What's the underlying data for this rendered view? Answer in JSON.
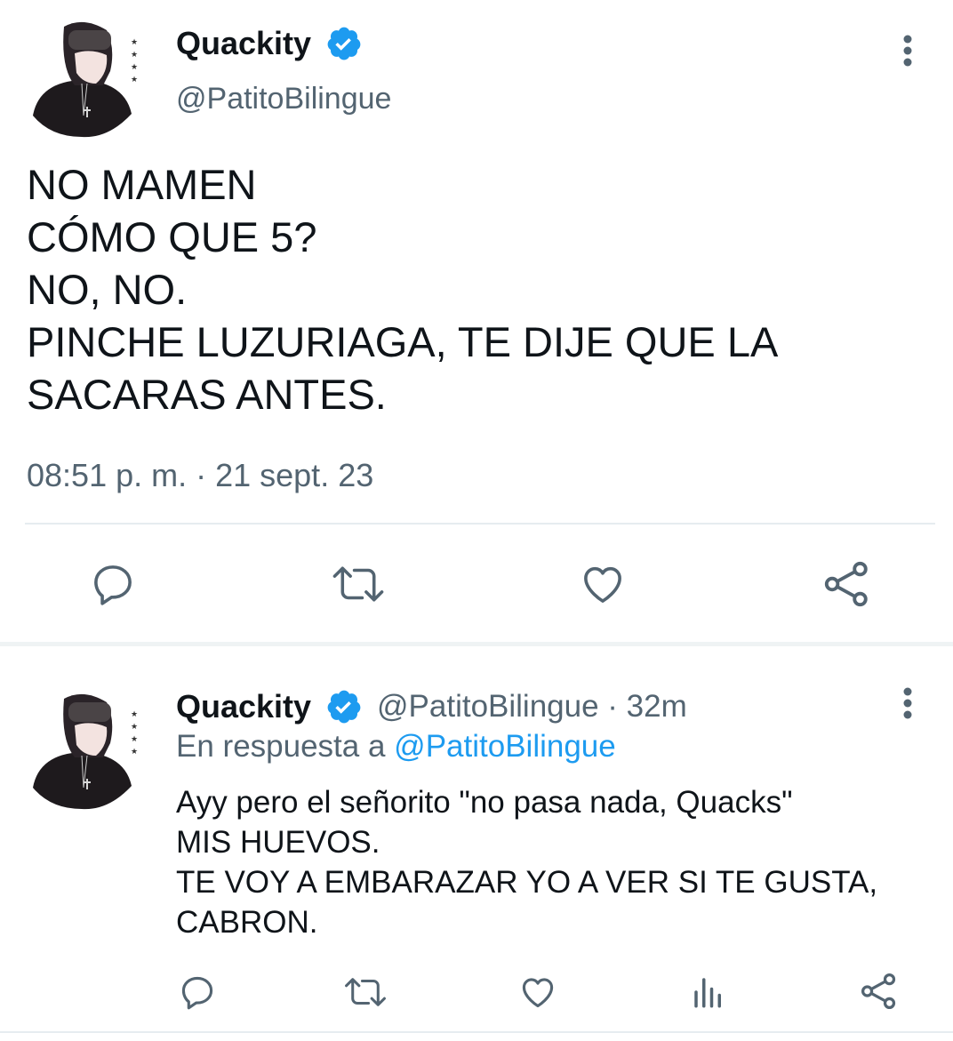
{
  "main_tweet": {
    "display_name": "Quackity",
    "handle": "@PatitoBilingue",
    "text": "NO MAMEN\nCÓMO QUE 5?\nNO, NO.\nPINCHE LUZURIAGA, TE DIJE QUE LA\nSACARAS ANTES.",
    "timestamp": "08:51 p. m. · 21 sept. 23",
    "actions": [
      "reply-icon",
      "retweet-icon",
      "like-icon",
      "share-icon"
    ]
  },
  "reply_tweet": {
    "display_name": "Quackity",
    "handle_time": "@PatitoBilingue · 32m",
    "reply_prefix": "En respuesta a",
    "reply_to": "@PatitoBilingue",
    "text": "Ayy pero el señorito \"no pasa nada, Quacks\"\nMIS HUEVOS.\nTE VOY A EMBARAZAR YO A VER SI TE GUSTA,\nCABRON.",
    "actions": [
      "reply-icon",
      "retweet-icon",
      "like-icon",
      "analytics-icon",
      "share-icon"
    ]
  },
  "colors": {
    "verified": "#1d9bf0",
    "text": "#0f1419",
    "muted": "#536471",
    "icon": "#536471"
  }
}
